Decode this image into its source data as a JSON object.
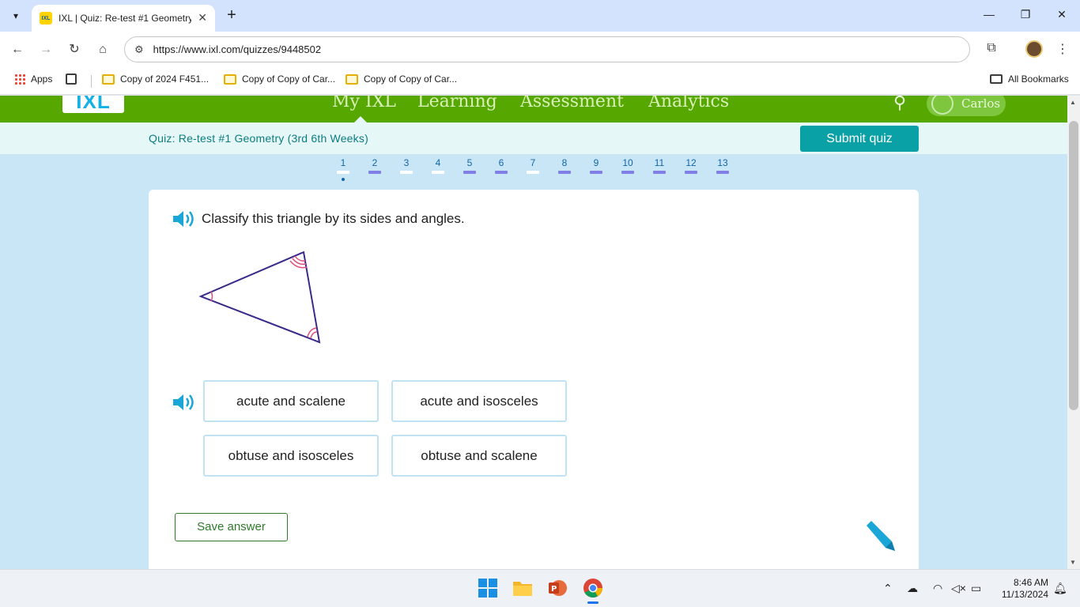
{
  "browser": {
    "tab_title": "IXL | Quiz: Re-test #1 Geometry",
    "favicon_text": "IXL",
    "url": "https://www.ixl.com/quizzes/9448502",
    "bookmarks": [
      "Apps",
      "Copy of 2024 F451...",
      "Copy of Copy of Car...",
      "Copy of Copy of Car..."
    ],
    "all_bookmarks": "All Bookmarks"
  },
  "ixl": {
    "logo": "IXL",
    "nav": [
      "My IXL",
      "Learning",
      "Assessment",
      "Analytics"
    ],
    "user_name": "Carlos",
    "quiz_title": "Quiz: Re-test #1 Geometry (3rd 6th Weeks)",
    "submit_label": "Submit quiz",
    "questions": [
      {
        "num": "1",
        "state": "current"
      },
      {
        "num": "2",
        "state": "answered"
      },
      {
        "num": "3",
        "state": "unanswered"
      },
      {
        "num": "4",
        "state": "unanswered"
      },
      {
        "num": "5",
        "state": "answered"
      },
      {
        "num": "6",
        "state": "answered"
      },
      {
        "num": "7",
        "state": "unanswered"
      },
      {
        "num": "8",
        "state": "answered"
      },
      {
        "num": "9",
        "state": "answered"
      },
      {
        "num": "10",
        "state": "answered"
      },
      {
        "num": "11",
        "state": "answered"
      },
      {
        "num": "12",
        "state": "answered"
      },
      {
        "num": "13",
        "state": "answered"
      }
    ],
    "question_text": "Classify this triangle by its sides and angles.",
    "choices": [
      "acute and scalene",
      "acute and isosceles",
      "obtuse and isosceles",
      "obtuse and scalene"
    ],
    "save_label": "Save answer",
    "colors": {
      "nav_green": "#56a800",
      "teal": "#0aa1a6",
      "answered": "#7f7fe6",
      "unanswered": "#ffffff",
      "triangle": "#3b2a8a",
      "angle_mark": "#e0507a"
    }
  },
  "taskbar": {
    "time": "8:46 AM",
    "date": "11/13/2024"
  }
}
